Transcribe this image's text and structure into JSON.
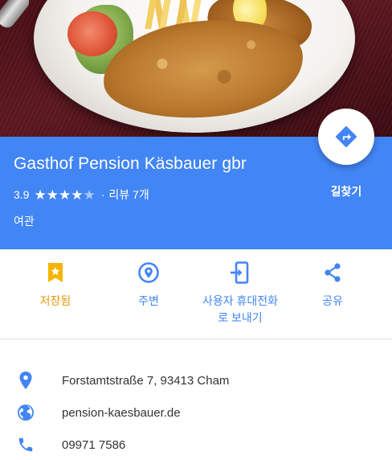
{
  "place": {
    "name": "Gasthof Pension Käsbauer gbr",
    "rating": "3.9",
    "rating_value": 3.9,
    "stars_max": 5,
    "separator": "·",
    "reviews": "리뷰 7개",
    "category": "여관"
  },
  "directions": {
    "label": "길찾기",
    "icon": "directions-icon"
  },
  "actions": [
    {
      "label": "저장됨",
      "icon": "bookmark-star-icon",
      "color": "#e69a10"
    },
    {
      "label": "주변",
      "icon": "nearby-pin-icon",
      "color": "#4285f4"
    },
    {
      "label": "사용자 휴대전화로 보내기",
      "label_line1": "사용자 휴대전화",
      "label_line2": "로 보내기",
      "icon": "send-to-phone-icon",
      "color": "#4285f4"
    },
    {
      "label": "공유",
      "icon": "share-icon",
      "color": "#4285f4"
    }
  ],
  "info": {
    "address": "Forstamtstraße 7, 93413 Cham",
    "website": "pension-kaesbauer.de",
    "phone": "09971 7586"
  },
  "colors": {
    "header_blue": "#4285f4",
    "accent_blue": "#4285f4",
    "saved_orange": "#e69a10",
    "text_dark": "#333333"
  }
}
